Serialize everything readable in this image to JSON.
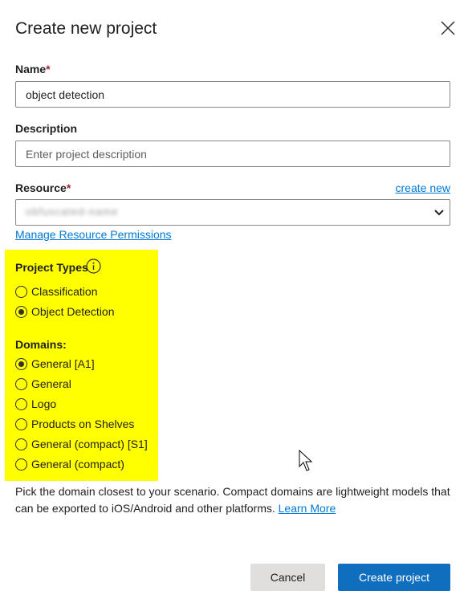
{
  "dialog": {
    "title": "Create new project",
    "close_icon": "close-icon"
  },
  "name": {
    "label": "Name",
    "required_mark": "*",
    "value": "object detection"
  },
  "description": {
    "label": "Description",
    "placeholder": "Enter project description",
    "value": ""
  },
  "resource": {
    "label": "Resource",
    "required_mark": "*",
    "create_new_link": "create new",
    "selected_value": "obfuscated-name",
    "manage_link": "Manage Resource Permissions"
  },
  "project_types": {
    "label": "Project Types",
    "info_icon": "info-icon",
    "options": [
      {
        "label": "Classification",
        "checked": false
      },
      {
        "label": "Object Detection",
        "checked": true
      }
    ]
  },
  "domains": {
    "label": "Domains:",
    "options": [
      {
        "label": "General [A1]",
        "checked": true
      },
      {
        "label": "General",
        "checked": false
      },
      {
        "label": "Logo",
        "checked": false
      },
      {
        "label": "Products on Shelves",
        "checked": false
      },
      {
        "label": "General (compact) [S1]",
        "checked": false
      },
      {
        "label": "General (compact)",
        "checked": false
      }
    ]
  },
  "help": {
    "text": "Pick the domain closest to your scenario. Compact domains are lightweight models that can be exported to iOS/Android and other platforms. ",
    "learn_more": "Learn More"
  },
  "buttons": {
    "cancel": "Cancel",
    "create": "Create project"
  },
  "colors": {
    "accent": "#106ebe",
    "link": "#0078d4",
    "highlight": "#ffff00",
    "required": "#a4262c"
  }
}
